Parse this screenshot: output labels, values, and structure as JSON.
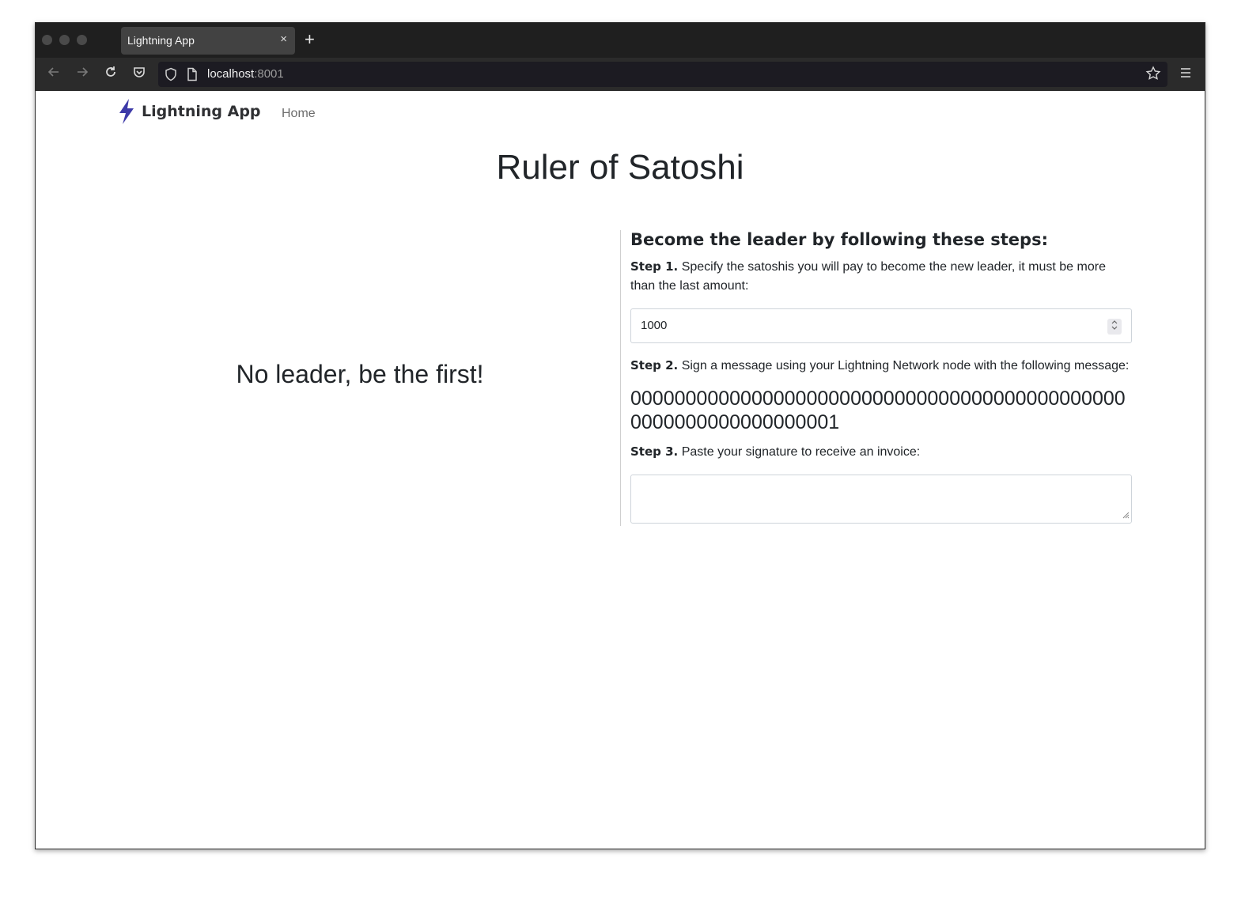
{
  "browser": {
    "tab_title": "Lightning App",
    "tab_close": "×",
    "new_tab": "+",
    "url_host": "localhost",
    "url_port": ":8001"
  },
  "navbar": {
    "brand": "Lightning App",
    "home_link": "Home"
  },
  "page": {
    "title": "Ruler of Satoshi",
    "leader_message": "No leader, be the first!"
  },
  "steps": {
    "heading": "Become the leader by following these steps:",
    "step1_label": "Step 1.",
    "step1_text": "Specify the satoshis you will pay to become the new leader, it must be more than the last amount:",
    "amount_value": "1000",
    "step2_label": "Step 2.",
    "step2_text": "Sign a message using your Lightning Network node with the following message:",
    "message": "0000000000000000000000000000000000000000000000000000000000000001",
    "step3_label": "Step 3.",
    "step3_text": "Paste your signature to receive an invoice:"
  },
  "colors": {
    "brand_bolt": "#3d3aa8",
    "tab_bg": "#424242",
    "toolbar_bg": "#2b2b2b"
  }
}
